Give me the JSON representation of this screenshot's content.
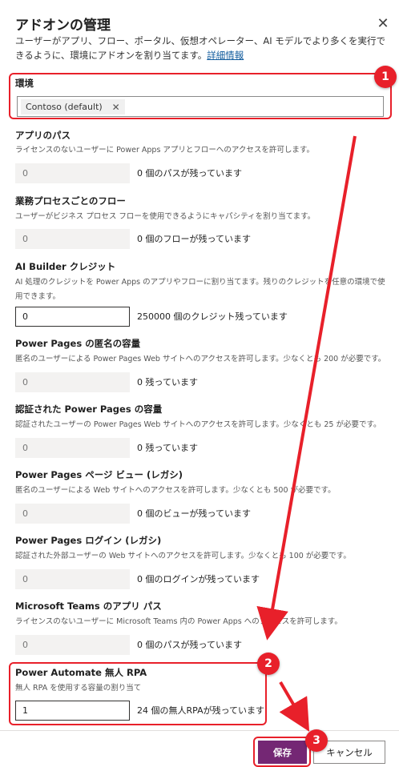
{
  "panel": {
    "title": "アドオンの管理",
    "description": "ユーザーがアプリ、フロー、ポータル、仮想オペレーター、AI モデルでより多くを実行できるように、環境にアドオンを割り当てます。",
    "learn_more": "詳細情報"
  },
  "environment": {
    "label": "環境",
    "selected": "Contoso (default)"
  },
  "sections": [
    {
      "title": "アプリのパス",
      "desc": "ライセンスのないユーザーに Power Apps アプリとフローへのアクセスを許可します。",
      "value": "0",
      "remaining": "0 個のパスが残っています"
    },
    {
      "title": "業務プロセスごとのフロー",
      "desc": "ユーザーがビジネス プロセス フローを使用できるようにキャパシティを割り当てます。",
      "value": "0",
      "remaining": "0 個のフローが残っています"
    },
    {
      "title": "AI Builder クレジット",
      "desc": "AI 処理のクレジットを Power Apps のアプリやフローに割り当てます。残りのクレジットを任意の環境で使用できます。",
      "value": "0",
      "remaining": "250000 個のクレジット残っています"
    },
    {
      "title": "Power Pages の匿名の容量",
      "desc": "匿名のユーザーによる Power Pages Web サイトへのアクセスを許可します。少なくとも 200 が必要です。",
      "value": "0",
      "remaining": "0 残っています"
    },
    {
      "title": "認証された Power Pages の容量",
      "desc": "認証されたユーザーの Power Pages Web サイトへのアクセスを許可します。少なくとも 25 が必要です。",
      "value": "0",
      "remaining": "0 残っています"
    },
    {
      "title": "Power Pages ページ ビュー (レガシ)",
      "desc": "匿名のユーザーによる Web サイトへのアクセスを許可します。少なくとも 500 が必要です。",
      "value": "0",
      "remaining": "0 個のビューが残っています"
    },
    {
      "title": "Power Pages ログイン (レガシ)",
      "desc": "認証された外部ユーザーの Web サイトへのアクセスを許可します。少なくとも 100 が必要です。",
      "value": "0",
      "remaining": "0 個のログインが残っています"
    },
    {
      "title": "Microsoft Teams のアプリ パス",
      "desc": "ライセンスのないユーザーに Microsoft Teams 内の Power Apps へのアクセスを許可します。",
      "value": "0",
      "remaining": "0 個のパスが残っています"
    },
    {
      "title": "Power Automate 無人 RPA",
      "desc": "無人 RPA を使用する容量の割り当て",
      "value": "1",
      "remaining": "24 個の無人RPAが残っています"
    }
  ],
  "footer": {
    "save_label": "保存",
    "cancel_label": "キャンセル"
  },
  "annotations": {
    "badge1": "1",
    "badge2": "2",
    "badge3": "3",
    "color": "#e8202a"
  },
  "colors": {
    "accent": "#742774",
    "link": "#0f5a9c"
  }
}
